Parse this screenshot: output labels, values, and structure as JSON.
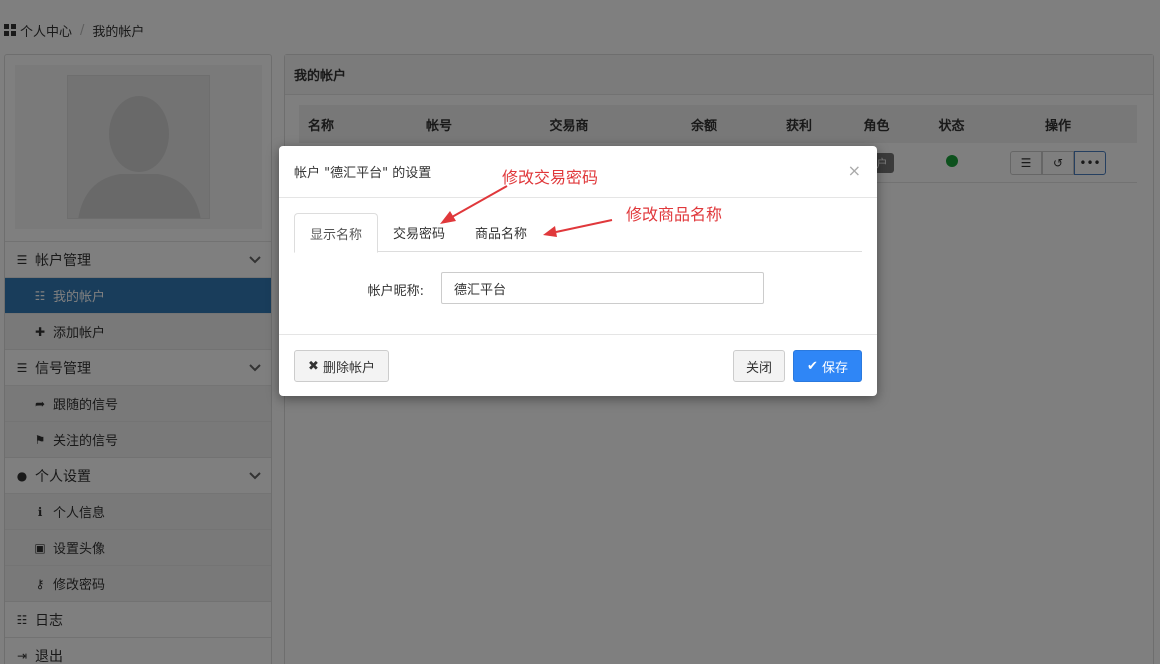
{
  "breadcrumb": {
    "home": "个人中心",
    "current": "我的帐户"
  },
  "sidebar": {
    "groups": [
      {
        "label": "帐户管理",
        "items": [
          "我的帐户",
          "添加帐户"
        ]
      },
      {
        "label": "信号管理",
        "items": [
          "跟随的信号",
          "关注的信号"
        ]
      },
      {
        "label": "个人设置",
        "items": [
          "个人信息",
          "设置头像",
          "修改密码"
        ]
      }
    ],
    "log": "日志",
    "logout": "退出"
  },
  "main": {
    "title": "我的帐户",
    "columns": [
      "名称",
      "帐号",
      "交易商",
      "余额",
      "获利",
      "角色",
      "状态",
      "操作"
    ],
    "row": {
      "role": "帐户"
    }
  },
  "modal": {
    "title": "帐户 \"德汇平台\" 的设置",
    "close_symbol": "×",
    "tabs": [
      "显示名称",
      "交易密码",
      "商品名称"
    ],
    "field_label": "帐户昵称:",
    "field_value": "德汇平台",
    "delete_label": "删除帐户",
    "close_label": "关闭",
    "save_label": "保存"
  },
  "annotations": {
    "a1": "修改交易密码",
    "a2": "修改商品名称"
  },
  "colors": {
    "primary": "#337ab7",
    "save": "#2f86f6",
    "annotation": "#e0383b",
    "status_ok": "#1aa33b"
  }
}
